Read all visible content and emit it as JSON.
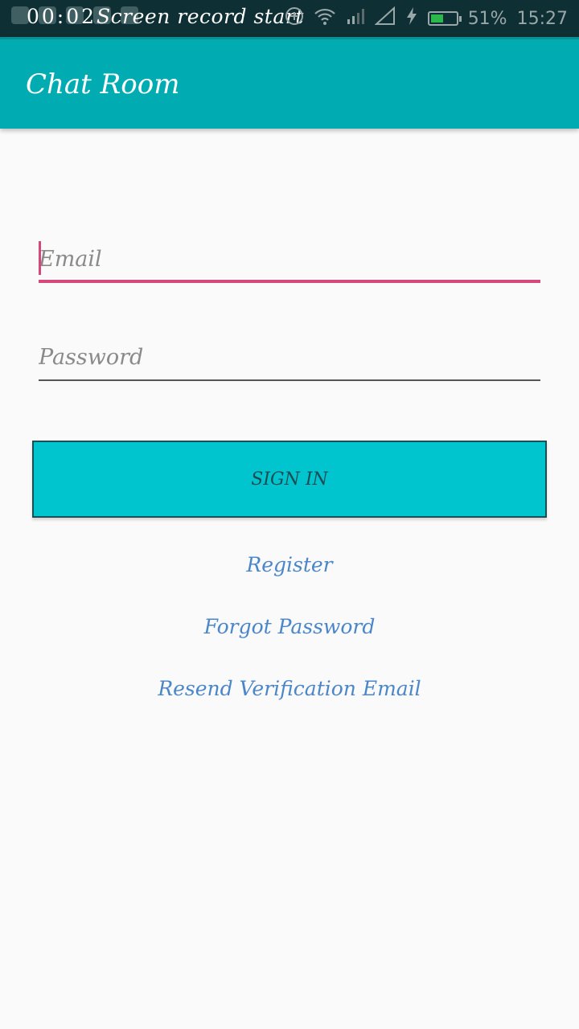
{
  "status_bar": {
    "recording_timer": "00:02",
    "recording_text": "Screen record start",
    "battery_percent": "51%",
    "battery_level": 0.51,
    "time": "15:27",
    "icons": [
      "whatsapp-icon",
      "notification-icon",
      "notification-icon",
      "notification-icon",
      "add-circle-icon",
      "wifi-icon",
      "signal-icon",
      "no-sim-icon",
      "charging-icon",
      "battery-icon"
    ],
    "battery_color": "#2db84b"
  },
  "app_bar": {
    "title": "Chat Room",
    "color": "#00acb1"
  },
  "form": {
    "email_placeholder": "Email",
    "password_placeholder": "Password",
    "focus_color": "#d4487a"
  },
  "buttons": {
    "sign_in": "SIGN IN",
    "sign_in_color": "#00c5cf"
  },
  "links": {
    "register": "Register",
    "forgot_password": "Forgot Password",
    "resend_verification": "Resend Verification Email",
    "color": "#4a86c8"
  }
}
